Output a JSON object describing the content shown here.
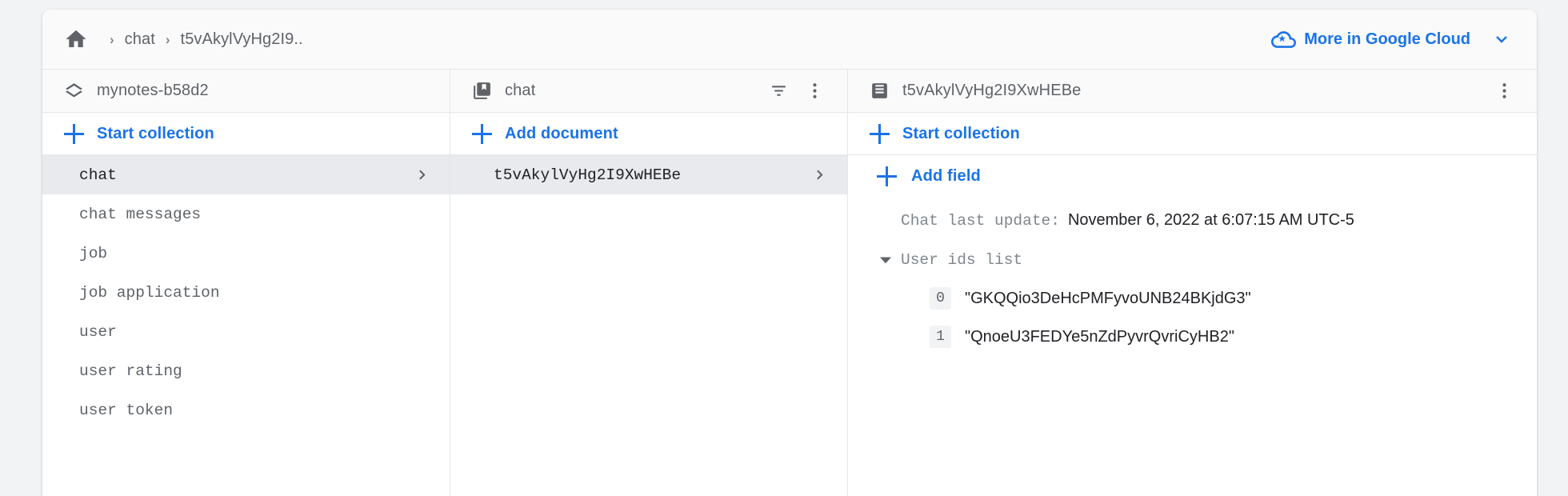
{
  "breadcrumb": {
    "home_icon": "home-icon",
    "separator": "›",
    "items": [
      {
        "label": "chat"
      },
      {
        "label": "t5vAkylVyHg2I9.."
      }
    ]
  },
  "header": {
    "more_cloud_label": "More in Google Cloud",
    "cloud_icon": "cloud-icon",
    "chevron_icon": "chevron-down-icon"
  },
  "panels": {
    "project": {
      "icon": "project-stack-icon",
      "title": "mynotes-b58d2",
      "add_label": "Start collection",
      "items": [
        {
          "label": "chat",
          "selected": true
        },
        {
          "label": "chat messages",
          "selected": false
        },
        {
          "label": "job",
          "selected": false
        },
        {
          "label": "job application",
          "selected": false
        },
        {
          "label": "user",
          "selected": false
        },
        {
          "label": "user rating",
          "selected": false
        },
        {
          "label": "user token",
          "selected": false
        }
      ]
    },
    "collection": {
      "icon": "collection-icon",
      "title": "chat",
      "filter_icon": "filter-icon",
      "menu_icon": "more-vert-icon",
      "add_label": "Add document",
      "items": [
        {
          "label": "t5vAkylVyHg2I9XwHEBe",
          "selected": true
        }
      ]
    },
    "document": {
      "icon": "document-icon",
      "title": "t5vAkylVyHg2I9XwHEBe",
      "menu_icon": "more-vert-icon",
      "start_collection_label": "Start collection",
      "add_field_label": "Add field",
      "fields": [
        {
          "key": "Chat last update:",
          "value": "November 6, 2022 at 6:07:15 AM UTC-5",
          "expandable": false
        },
        {
          "key": "User ids list",
          "value": "",
          "expandable": true,
          "expanded": true,
          "array": [
            {
              "index": "0",
              "value": "\"GKQQio3DeHcPMFyvoUNB24BKjdG3\""
            },
            {
              "index": "1",
              "value": "\"QnoeU3FEDYe5nZdPyvrQvriCyHB2\""
            }
          ]
        }
      ]
    }
  },
  "colors": {
    "accent_blue": "#1a73e8",
    "text_gray": "#5f6368",
    "selected_bg": "#e8eaed",
    "panel_head_bg": "#fafafa",
    "border": "#e4e6e8"
  }
}
